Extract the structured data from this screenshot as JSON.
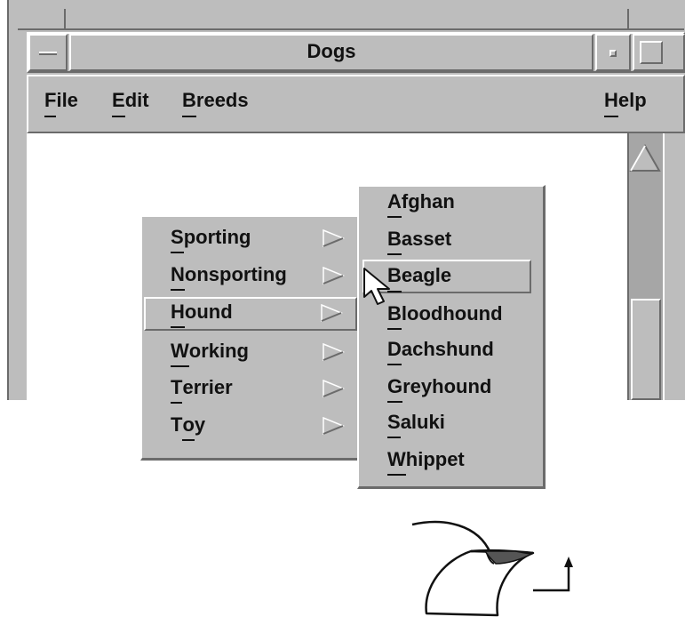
{
  "window": {
    "title": "Dogs",
    "menubar": {
      "file": {
        "label": "File",
        "mnemonic": "F",
        "rest": "ile"
      },
      "edit": {
        "label": "Edit",
        "mnemonic": "E",
        "rest": "dit"
      },
      "breeds": {
        "label": "Breeds",
        "mnemonic": "B",
        "rest": "reeds"
      },
      "help": {
        "label": "Help",
        "mnemonic": "H",
        "rest": "elp"
      }
    }
  },
  "breeds_menu": {
    "items": [
      {
        "label": "Sporting",
        "mnemonic": "S",
        "rest": "porting",
        "pre": ""
      },
      {
        "label": "Nonsporting",
        "mnemonic": "N",
        "rest": "onsporting",
        "pre": ""
      },
      {
        "label": "Hound",
        "mnemonic": "H",
        "rest": "ound",
        "pre": "",
        "highlighted": true
      },
      {
        "label": "Working",
        "mnemonic": "W",
        "rest": "orking",
        "pre": ""
      },
      {
        "label": "Terrier",
        "mnemonic": "T",
        "rest": "errier",
        "pre": ""
      },
      {
        "label": "Toy",
        "mnemonic": "o",
        "rest": "y",
        "pre": "T"
      }
    ]
  },
  "hound_submenu": {
    "items": [
      {
        "label": "Afghan",
        "mnemonic": "A",
        "rest": "fghan"
      },
      {
        "label": "Basset",
        "mnemonic": "B",
        "rest": "asset"
      },
      {
        "label": "Beagle",
        "mnemonic": "B",
        "rest": "eagle",
        "selected": true
      },
      {
        "label": "Bloodhound",
        "mnemonic": "B",
        "rest": "loodhound"
      },
      {
        "label": "Dachshund",
        "mnemonic": "D",
        "rest": "achshund"
      },
      {
        "label": "Greyhound",
        "mnemonic": "G",
        "rest": "reyhound"
      },
      {
        "label": "Saluki",
        "mnemonic": "S",
        "rest": "aluki"
      },
      {
        "label": "Whippet",
        "mnemonic": "W",
        "rest": "hippet"
      }
    ]
  },
  "colors": {
    "frame": "#bdbdbd",
    "shadow": "#6b6b6b",
    "highlight": "#ffffff",
    "text": "#111111"
  }
}
